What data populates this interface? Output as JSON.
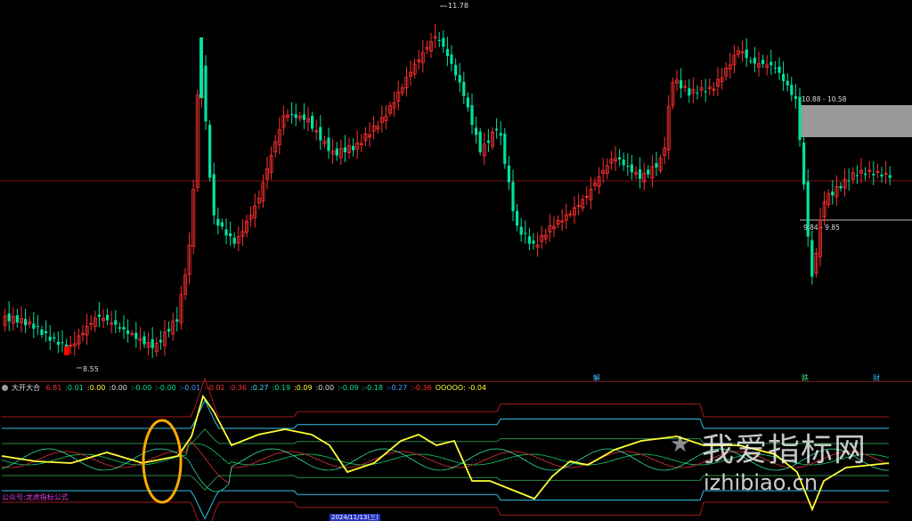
{
  "colors": {
    "up": "#ff3030",
    "down": "#00e0a0",
    "bg": "#000000",
    "yellow": "#ffff33",
    "orange": "#ffaa00"
  },
  "price_labels": {
    "high": "11.78",
    "low": "8.55",
    "zone_upper": "10.88 - 10.58",
    "zone_lower": "9.84 - 9.85"
  },
  "markers": [
    "解",
    "跌",
    "财"
  ],
  "indicator": {
    "name": "大开大合",
    "values": [
      {
        "text": "6.81",
        "color": "#ff3030"
      },
      {
        "text": ":0.01",
        "color": "#00e0a0"
      },
      {
        "text": ":0.00",
        "color": "#ffff33"
      },
      {
        "text": ":0.00",
        "color": "#dddddd"
      },
      {
        "text": ":-0.00",
        "color": "#00e0a0"
      },
      {
        "text": ":-0.00",
        "color": "#00e0a0"
      },
      {
        "text": ":-0.01",
        "color": "#40a0ff"
      },
      {
        "text": ":-0.01",
        "color": "#ff3030"
      },
      {
        "text": ":0.36",
        "color": "#ff3030"
      },
      {
        "text": ":0.27",
        "color": "#40e0ff"
      },
      {
        "text": ":0.19",
        "color": "#00e0a0"
      },
      {
        "text": ":0.09",
        "color": "#ffff33"
      },
      {
        "text": ":0.00",
        "color": "#dddddd"
      },
      {
        "text": ":-0.09",
        "color": "#00e0a0"
      },
      {
        "text": ":-0.18",
        "color": "#00e0a0"
      },
      {
        "text": ":-0.27",
        "color": "#40a0ff"
      },
      {
        "text": ":-0.36",
        "color": "#ff3030"
      },
      {
        "text": "OOOOO: -0.04",
        "color": "#ffff33"
      }
    ]
  },
  "watermark": {
    "cn": "我爱指标网",
    "url": "izhibiao.cn"
  },
  "note": "公众号:龙虎指标公式",
  "date_badge": "2024/11/13(三)"
}
